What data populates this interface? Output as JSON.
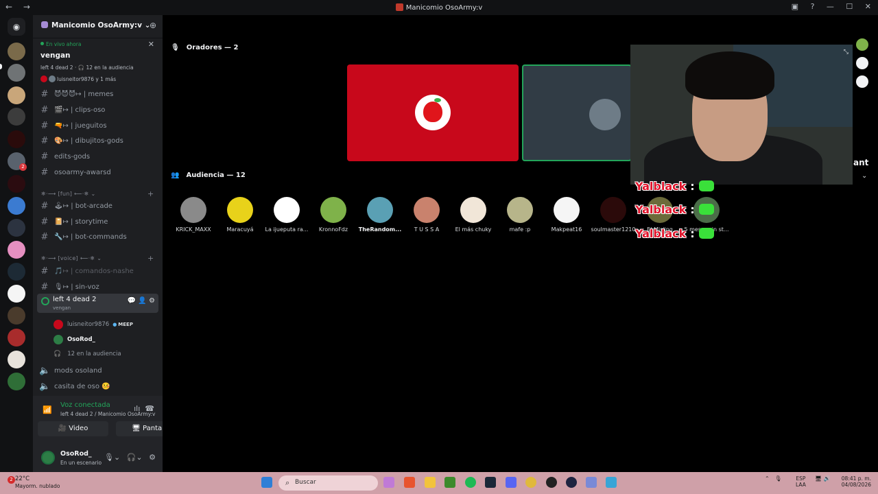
{
  "window": {
    "title": "Manicomio OsoArmy:v",
    "back": "←",
    "forward": "→",
    "controls": [
      "▣",
      "?",
      "—",
      "☐",
      "✕"
    ]
  },
  "colors": {
    "accent_green": "#23a55a",
    "stage_red": "#c8081b",
    "overlay_red": "#e0142b"
  },
  "server": {
    "name": "Manicomio OsoArmy:v ⌄",
    "invite_icon": "person-add"
  },
  "live": {
    "tag": "En vivo ahora",
    "topic": "vengan",
    "meta": "left 4 dead 2 · 🎧 12 en la audiencia",
    "speakers": "luisneitor9876 y 1 más"
  },
  "channels": [
    {
      "label": "😈😈😈↦ | memes"
    },
    {
      "label": "🎬↦ | clips-oso"
    },
    {
      "label": "🔫↦ | jueguitos"
    },
    {
      "label": "🎨↦ | dibujitos-gods"
    },
    {
      "label": "edits-gods"
    },
    {
      "label": "osoarmy-awarsd"
    }
  ],
  "cat_fun": "❄·⟶ [fun] ⟵·❄ ⌄",
  "fun_channels": [
    {
      "label": "🕹↦ | bot-arcade"
    },
    {
      "label": "📔↦ | storytime"
    },
    {
      "label": "🔧↦ | bot-commands"
    }
  ],
  "cat_voice": "❄·⟶ [voice] ⟵·❄ ⌄",
  "voice_channels": [
    {
      "label": "🎵↦ | comandos-nashe"
    },
    {
      "label": "🎙↦ | sin-voz"
    }
  ],
  "active_voice": {
    "name": "left 4 dead 2",
    "sub": "vengan",
    "actions": "💬 👤 ⚙"
  },
  "voice_users": [
    {
      "name": "luisneitor9876",
      "badge": "MEEP"
    },
    {
      "name": "OsoRod_"
    },
    {
      "name": "12 en la audiencia"
    }
  ],
  "more_voice": [
    {
      "label": "mods osoland"
    },
    {
      "label": "casita de oso 🤒"
    }
  ],
  "voice_bar": {
    "title": "Voz conectada",
    "sub": "left 4 dead 2 / Manicomio OsoArmy:v",
    "video": "Video",
    "screen": "Pantalla"
  },
  "user": {
    "name": "OsoRod_",
    "status": "En un escenario"
  },
  "stage": {
    "speakers_header": "Oradores — 2",
    "audience_header": "Audiencia — 12",
    "ant": "ant"
  },
  "audience": [
    {
      "name": "KRICK_MAXX",
      "color": "#8a8a8a"
    },
    {
      "name": "Maracuyá",
      "color": "#e8d21a"
    },
    {
      "name": "La ijueputa ra...",
      "color": "#ffffff"
    },
    {
      "name": "KronnoFdz",
      "color": "#7fb24a"
    },
    {
      "name": "TheRandom...",
      "color": "#5aa0b4",
      "bold": true
    },
    {
      "name": "T U S S A",
      "color": "#c9826d"
    },
    {
      "name": "El más chuky",
      "color": "#f1e6d8"
    },
    {
      "name": "mafe :p",
      "color": "#b7b58a"
    },
    {
      "name": "Makpeat16",
      "color": "#f5f5f5"
    },
    {
      "name": "soulmaster1210",
      "color": "#2b0a0a"
    },
    {
      "name": "El Misiing",
      "color": "#6b6b3a"
    },
    {
      "name": "5 meses sin st...",
      "color": "#4b6d48"
    }
  ],
  "overlay": [
    "Yalblack",
    "Yalblack",
    "Yalblack"
  ],
  "taskbar": {
    "temp": "22°C",
    "weather": "Mayorm. nublado",
    "weather_badge": "2",
    "search": "Buscar",
    "lang1": "ESP",
    "lang2": "LAA",
    "time": "08:41 p. m.",
    "date": "04/08/2026"
  }
}
